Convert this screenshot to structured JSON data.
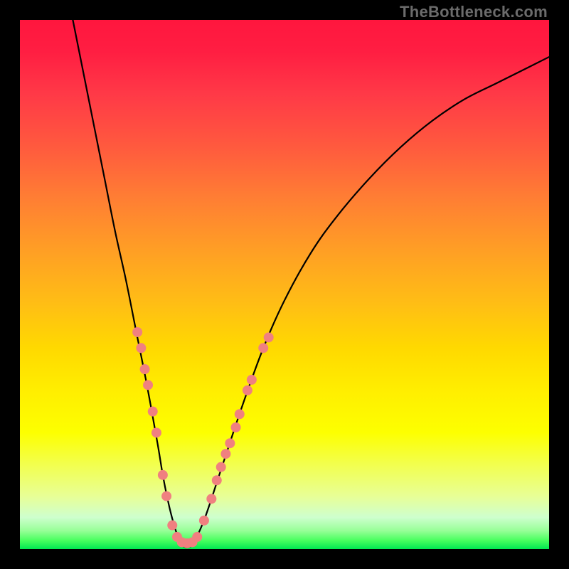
{
  "watermark": "TheBottleneck.com",
  "chart_data": {
    "type": "line",
    "title": "",
    "xlabel": "",
    "ylabel": "",
    "xlim": [
      0,
      100
    ],
    "ylim": [
      0,
      100
    ],
    "grid": false,
    "legend": false,
    "series": [
      {
        "name": "bottleneck-curve",
        "x": [
          10,
          12,
          14,
          16,
          18,
          20,
          22,
          24,
          26,
          27,
          28,
          29,
          30,
          31,
          32,
          33,
          35,
          38,
          42,
          46,
          50,
          55,
          60,
          66,
          72,
          78,
          84,
          90,
          96,
          100
        ],
        "y": [
          100,
          90,
          80,
          70,
          60,
          51,
          41,
          31,
          20,
          14,
          9,
          5,
          2,
          0.5,
          0.4,
          1.5,
          6,
          15,
          27,
          38,
          47,
          56,
          63,
          70,
          76,
          81,
          85,
          88,
          91,
          93
        ]
      }
    ],
    "markers": {
      "name": "highlight-dots",
      "color": "#f08080",
      "radius_px": 7,
      "points": [
        {
          "x": 22.2,
          "y": 41
        },
        {
          "x": 22.9,
          "y": 38
        },
        {
          "x": 23.6,
          "y": 34
        },
        {
          "x": 24.2,
          "y": 31
        },
        {
          "x": 25.1,
          "y": 26
        },
        {
          "x": 25.8,
          "y": 22
        },
        {
          "x": 27.0,
          "y": 14
        },
        {
          "x": 27.7,
          "y": 10
        },
        {
          "x": 28.8,
          "y": 4.5
        },
        {
          "x": 29.7,
          "y": 2.3
        },
        {
          "x": 30.6,
          "y": 1.3
        },
        {
          "x": 31.6,
          "y": 1.1
        },
        {
          "x": 32.6,
          "y": 1.3
        },
        {
          "x": 33.5,
          "y": 2.3
        },
        {
          "x": 34.8,
          "y": 5.4
        },
        {
          "x": 36.2,
          "y": 9.5
        },
        {
          "x": 37.2,
          "y": 13
        },
        {
          "x": 38.0,
          "y": 15.5
        },
        {
          "x": 38.9,
          "y": 18
        },
        {
          "x": 39.7,
          "y": 20
        },
        {
          "x": 40.8,
          "y": 23
        },
        {
          "x": 41.5,
          "y": 25.5
        },
        {
          "x": 43.0,
          "y": 30
        },
        {
          "x": 43.8,
          "y": 32
        },
        {
          "x": 46.0,
          "y": 38
        },
        {
          "x": 47.0,
          "y": 40
        }
      ]
    },
    "gradient_stops": [
      {
        "pos": 0.0,
        "color": "#ff163e"
      },
      {
        "pos": 0.3,
        "color": "#ff7a33"
      },
      {
        "pos": 0.6,
        "color": "#ffd900"
      },
      {
        "pos": 0.8,
        "color": "#fdff00"
      },
      {
        "pos": 0.95,
        "color": "#b0ffb0"
      },
      {
        "pos": 1.0,
        "color": "#00e852"
      }
    ]
  }
}
